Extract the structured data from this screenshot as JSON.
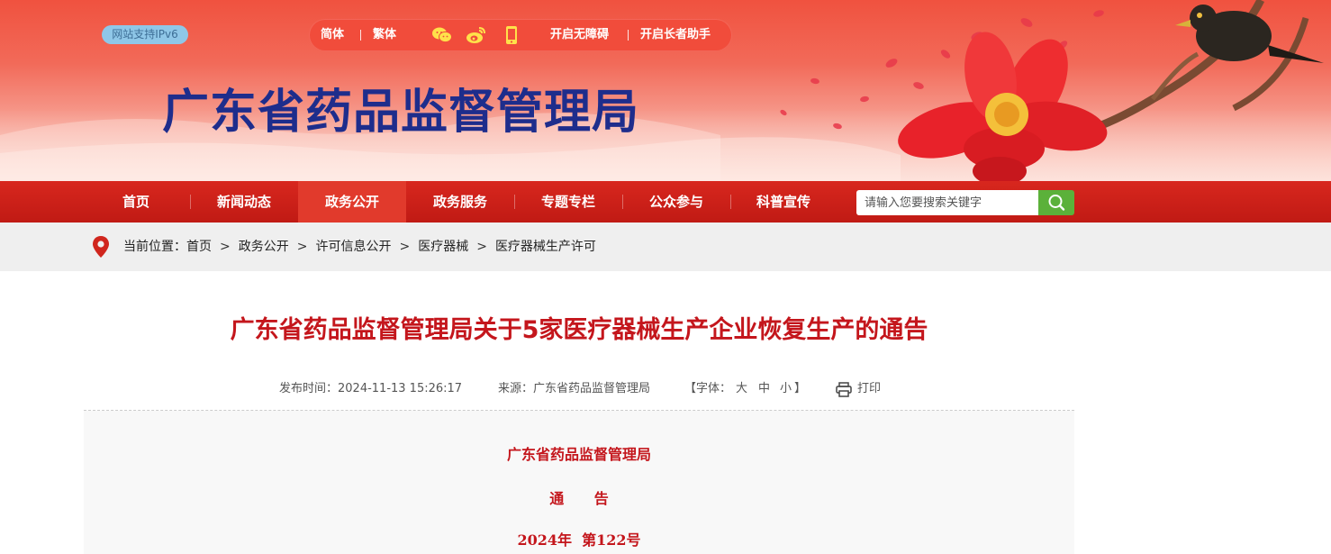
{
  "header": {
    "ipv6_badge": "网站支持IPv6",
    "toolbar": {
      "simplified": "简体",
      "traditional": "繁体",
      "accessibility": "开启无障碍",
      "elderly_assist": "开启长者助手"
    },
    "site_title": "广东省药品监督管理局"
  },
  "nav": {
    "items": [
      "首页",
      "新闻动态",
      "政务公开",
      "政务服务",
      "专题专栏",
      "公众参与",
      "科普宣传"
    ],
    "active": "政务公开",
    "search_placeholder": "请输入您要搜索关键字"
  },
  "breadcrumb": {
    "prefix": "当前位置：",
    "items": [
      "首页",
      "政务公开",
      "许可信息公开",
      "医疗器械",
      "医疗器械生产许可"
    ],
    "separator": ">"
  },
  "article": {
    "title": "广东省药品监督管理局关于5家医疗器械生产企业恢复生产的通告",
    "publish_time": "发布时间：2024-11-13 15:26:17",
    "source": "来源：广东省药品监督管理局",
    "font_size_label": "【字体：",
    "font_large": "大",
    "font_medium": "中",
    "font_small": "小",
    "font_size_close": "】",
    "print_label": "打印",
    "doc_issuer": "广东省药品监督管理局",
    "doc_type": "通      告",
    "doc_number": "2024年  第122号"
  },
  "colors": {
    "nav_red": "#c01a14",
    "title_red": "#c4161c",
    "site_title_blue": "#1e2d8c",
    "search_green": "#5bb13a"
  },
  "icons": [
    "wechat-icon",
    "weibo-icon",
    "mobile-icon",
    "search-icon",
    "location-pin-icon",
    "printer-icon"
  ]
}
